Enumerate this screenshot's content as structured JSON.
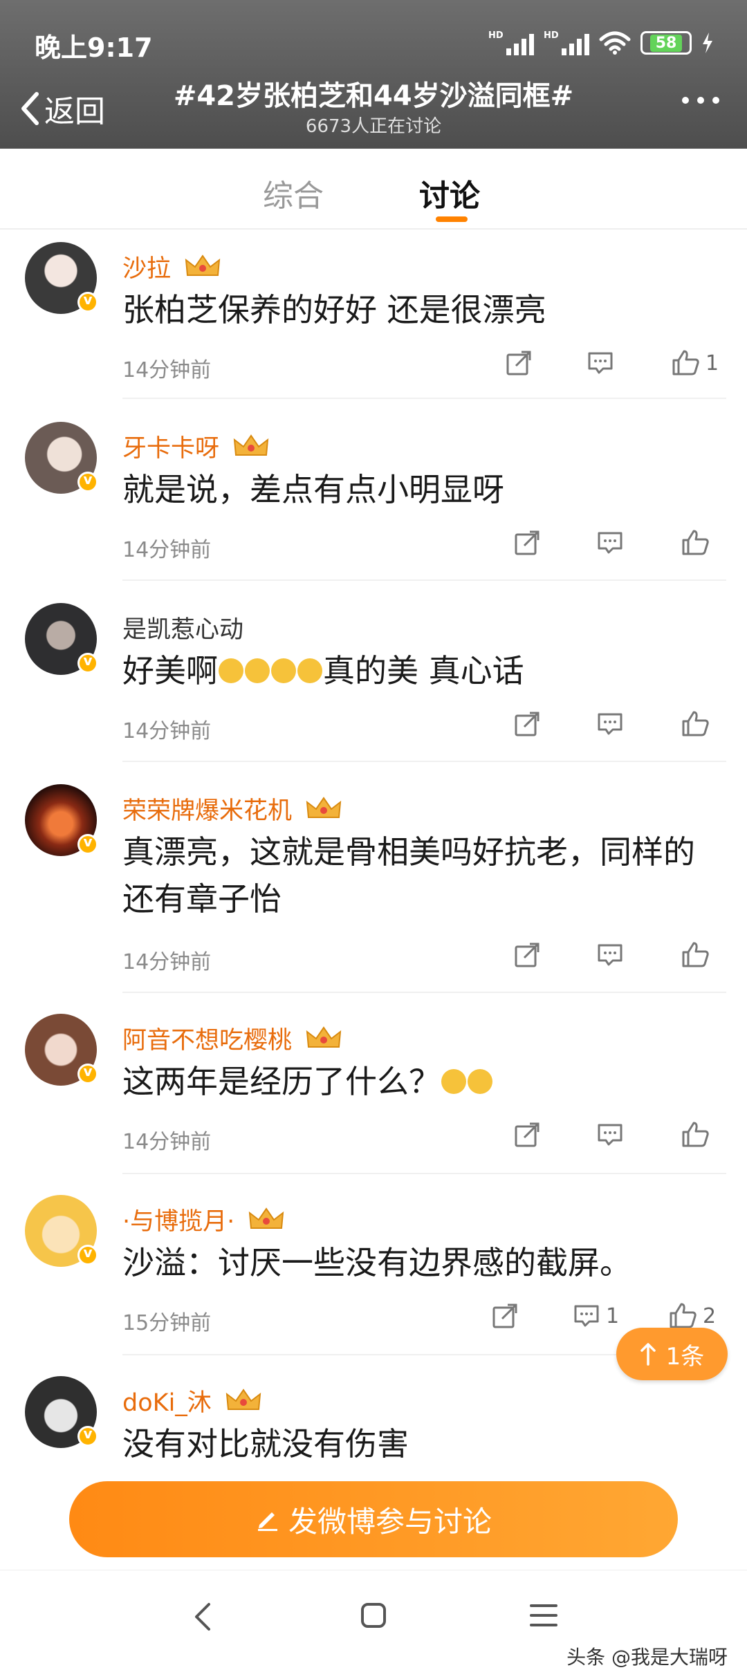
{
  "status_bar": {
    "time": "晚上9:17",
    "signal_1": "HD",
    "signal_2": "HD",
    "battery": "58"
  },
  "header": {
    "back_label": "返回",
    "title": "#42岁张柏芝和44岁沙溢同框#",
    "subtitle": "6673人正在讨论"
  },
  "tabs": [
    {
      "label": "综合"
    },
    {
      "label": "讨论"
    }
  ],
  "comments": [
    {
      "name": "沙拉",
      "text": "张柏芝保养的好好 还是很漂亮",
      "time": "14分钟前",
      "comment_count": "",
      "like_count": "1"
    },
    {
      "name": "牙卡卡呀",
      "text": "就是说，差点有点小明显呀",
      "time": "14分钟前",
      "comment_count": "",
      "like_count": ""
    },
    {
      "name": "是凯惹心动",
      "text_a": "好美啊",
      "text_b": "真的美 真心话",
      "time": "14分钟前",
      "comment_count": "",
      "like_count": ""
    },
    {
      "name": "荣荣牌爆米花机",
      "text": "真漂亮，这就是骨相美吗好抗老，同样的还有章子怡",
      "time": "14分钟前",
      "comment_count": "",
      "like_count": ""
    },
    {
      "name": "阿音不想吃樱桃",
      "text": "这两年是经历了什么？",
      "time": "14分钟前",
      "comment_count": "",
      "like_count": ""
    },
    {
      "name": "·与博揽月·",
      "text": "沙溢：讨厌一些没有边界感的截屏。",
      "time": "15分钟前",
      "comment_count": "1",
      "like_count": "2"
    },
    {
      "name": "doKi_沐",
      "text": "没有对比就没有伤害",
      "time": "",
      "comment_count": "",
      "like_count": ""
    }
  ],
  "new_items_button": "1条",
  "post_button": "发微博参与讨论",
  "watermark": "头条 @我是大瑞呀",
  "icons": {
    "share": "share-icon",
    "comment": "comment-icon",
    "like": "thumbs-up-icon",
    "crown": "crown-icon",
    "back": "chevron-left-icon",
    "more": "more-dots-icon"
  },
  "colors": {
    "accent": "#ff8200",
    "name_orange": "#e86c0c",
    "header_bg": "#5a5a5a"
  }
}
